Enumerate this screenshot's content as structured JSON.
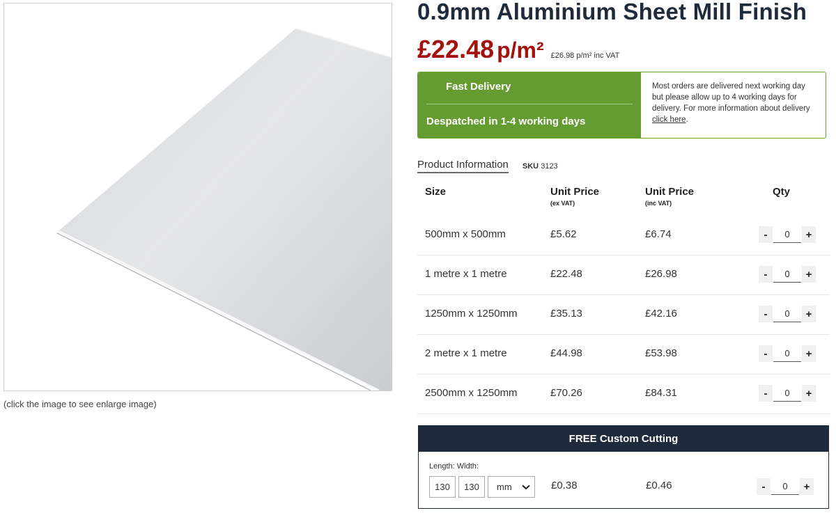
{
  "product": {
    "title": "0.9mm Aluminium Sheet Mill Finish",
    "price": "£22.48",
    "price_unit": "p/m²",
    "price_inc_vat": "£26.98 p/m² inc VAT",
    "image_caption": "(click the image to see enlarge image)"
  },
  "delivery": {
    "fast_label": "Fast Delivery",
    "despatch_label": "Despatched in 1-4 working days",
    "info_text": "Most orders are delivered next working day but please allow up to 4 working days for delivery. For more information about delivery ",
    "info_link": "click here",
    "info_end": "."
  },
  "tabs": {
    "product_info": "Product Information",
    "sku_label": "SKU",
    "sku_value": "3123"
  },
  "table": {
    "headers": {
      "size": "Size",
      "unit_price": "Unit Price",
      "ex_vat": "(ex VAT)",
      "unit_price_inc": "Unit Price",
      "inc_vat": "(inc VAT)",
      "qty": "Qty"
    },
    "rows": [
      {
        "size": "500mm x 500mm",
        "ex": "£5.62",
        "inc": "£6.74",
        "qty": "0"
      },
      {
        "size": "1 metre x 1 metre",
        "ex": "£22.48",
        "inc": "£26.98",
        "qty": "0"
      },
      {
        "size": "1250mm x 1250mm",
        "ex": "£35.13",
        "inc": "£42.16",
        "qty": "0"
      },
      {
        "size": "2 metre x 1 metre",
        "ex": "£44.98",
        "inc": "£53.98",
        "qty": "0"
      },
      {
        "size": "2500mm x 1250mm",
        "ex": "£70.26",
        "inc": "£84.31",
        "qty": "0"
      }
    ],
    "minus": "-",
    "plus": "+"
  },
  "custom_cut": {
    "header": "FREE Custom Cutting",
    "length_label": "Length:",
    "width_label": "Width:",
    "length_value": "130",
    "width_value": "130",
    "unit": "mm",
    "ex": "£0.38",
    "inc": "£0.46",
    "qty": "0"
  },
  "icons": {
    "dropdown": "chevron-down-icon"
  }
}
